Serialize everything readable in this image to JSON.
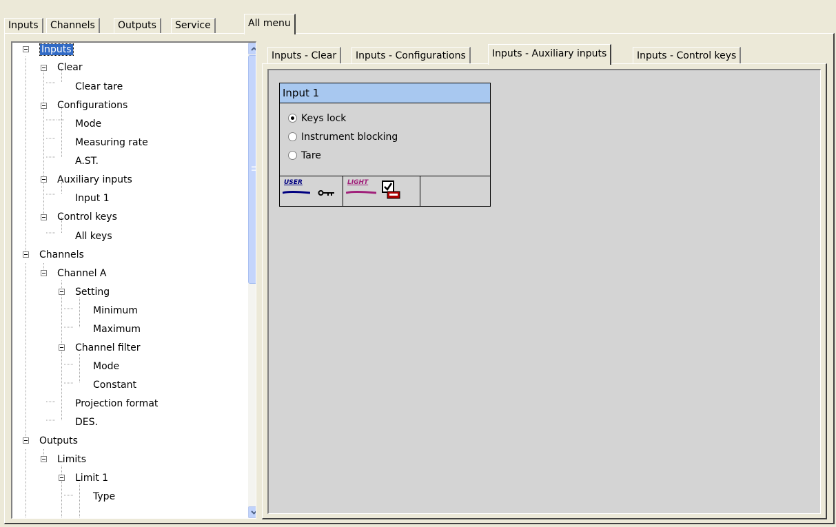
{
  "top_tabs": [
    "Inputs",
    "Channels",
    "Outputs",
    "Service",
    "All menu"
  ],
  "active_top_tab": "All menu",
  "tree": [
    {
      "label": "Inputs",
      "level": 0,
      "expander": true,
      "selected": true
    },
    {
      "label": "Clear",
      "level": 1,
      "expander": true
    },
    {
      "label": "Clear tare",
      "level": 2
    },
    {
      "label": "Configurations",
      "level": 1,
      "expander": true
    },
    {
      "label": "Mode",
      "level": 2
    },
    {
      "label": "Measuring rate",
      "level": 2
    },
    {
      "label": "A.ST.",
      "level": 2
    },
    {
      "label": "Auxiliary inputs",
      "level": 1,
      "expander": true
    },
    {
      "label": "Input 1",
      "level": 2
    },
    {
      "label": "Control keys",
      "level": 1,
      "expander": true
    },
    {
      "label": "All keys",
      "level": 2
    },
    {
      "label": "Channels",
      "level": 0,
      "expander": true
    },
    {
      "label": "Channel A",
      "level": 1,
      "expander": true
    },
    {
      "label": "Setting",
      "level": 2,
      "expander": true
    },
    {
      "label": "Minimum",
      "level": 3
    },
    {
      "label": "Maximum",
      "level": 3
    },
    {
      "label": "Channel filter",
      "level": 2,
      "expander": true
    },
    {
      "label": "Mode",
      "level": 3
    },
    {
      "label": "Constant",
      "level": 3
    },
    {
      "label": "Projection format",
      "level": 2
    },
    {
      "label": "DES.",
      "level": 2
    },
    {
      "label": "Outputs",
      "level": 0,
      "expander": true
    },
    {
      "label": "Limits",
      "level": 1,
      "expander": true
    },
    {
      "label": "Limit 1",
      "level": 2,
      "expander": true
    },
    {
      "label": "Type",
      "level": 3
    }
  ],
  "inner_tabs": [
    "Inputs - Clear",
    "Inputs - Configurations",
    "Inputs - Auxiliary inputs",
    "Inputs - Control keys"
  ],
  "active_inner_tab": "Inputs - Auxiliary inputs",
  "input_box": {
    "title": "Input 1",
    "options": [
      {
        "label": "Keys lock",
        "checked": true
      },
      {
        "label": "Instrument blocking",
        "checked": false
      },
      {
        "label": "Tare",
        "checked": false
      }
    ],
    "user_tag": "USER",
    "light_tag": "LIGHT"
  },
  "colors": {
    "window_bg": "#ece9d8",
    "content_bg": "#d4d4d4",
    "selection": "#316ac5",
    "title_bar": "#a8c8f0",
    "user_tag": "#000080",
    "light_tag": "#a0207a"
  }
}
